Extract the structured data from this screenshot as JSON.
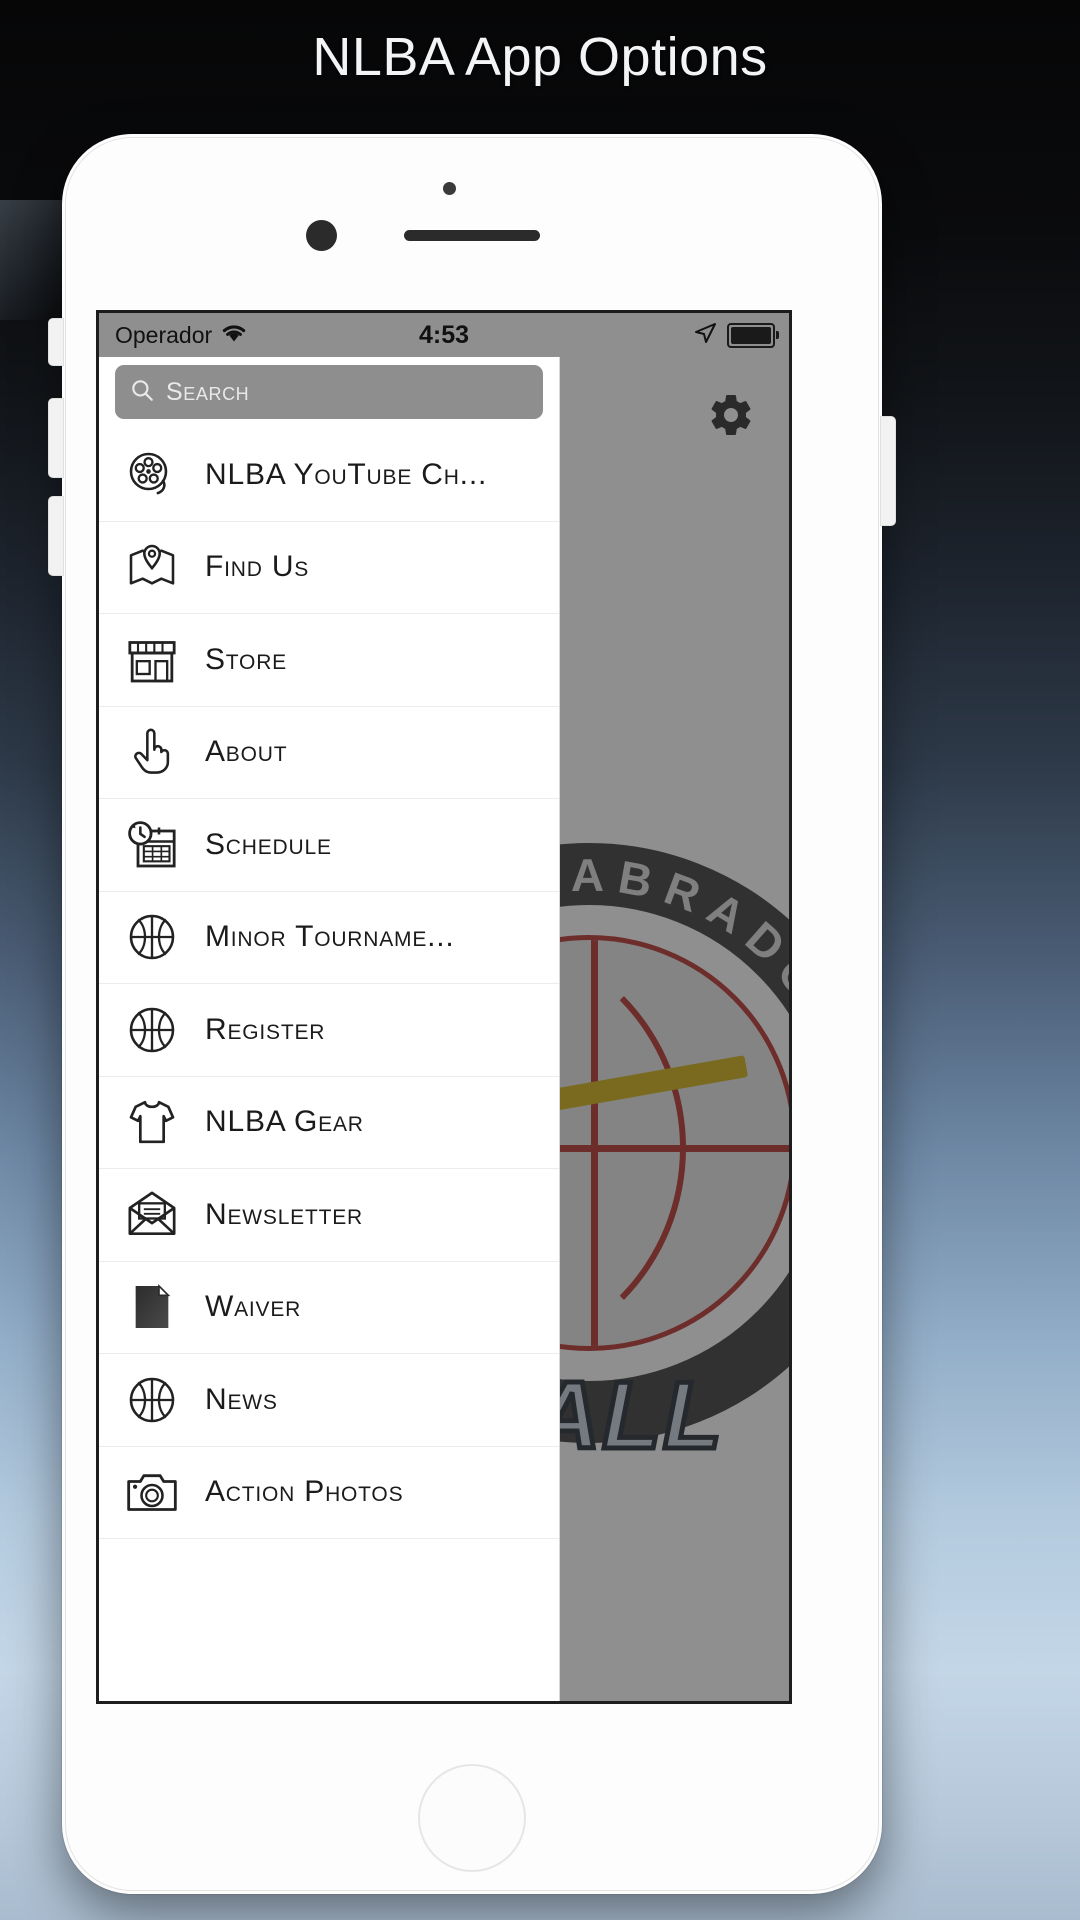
{
  "page": {
    "title": "NLBA App Options"
  },
  "device": {
    "status_bar": {
      "carrier": "Operador",
      "wifi_icon": "wifi-icon",
      "time": "4:53",
      "location_icon": "location-arrow-icon",
      "battery_icon": "battery-full-icon"
    },
    "home_button": "home-button"
  },
  "app": {
    "settings_icon": "gear-icon",
    "search": {
      "placeholder": "Search",
      "value": "",
      "icon": "search-icon"
    },
    "menu": [
      {
        "label": "NLBA YouTube Ch...",
        "icon": "film-reel-icon"
      },
      {
        "label": "Find Us",
        "icon": "map-pin-icon"
      },
      {
        "label": "Store",
        "icon": "storefront-icon"
      },
      {
        "label": "About",
        "icon": "pointing-hand-icon"
      },
      {
        "label": "Schedule",
        "icon": "calendar-clock-icon"
      },
      {
        "label": "Minor Tourname...",
        "icon": "basketball-icon"
      },
      {
        "label": "Register",
        "icon": "basketball-icon"
      },
      {
        "label": "NLBA Gear",
        "icon": "tshirt-icon"
      },
      {
        "label": "Newsletter",
        "icon": "envelope-open-icon"
      },
      {
        "label": "Waiver",
        "icon": "document-icon"
      },
      {
        "label": "News",
        "icon": "basketball-icon"
      },
      {
        "label": "Action Photos",
        "icon": "camera-icon"
      }
    ],
    "background_logo": {
      "ring_text": "O & LABRADOR",
      "word_text": "TBALL"
    }
  },
  "colors": {
    "logo_ring": "#3c3c3c",
    "logo_ball_line": "#b9322f",
    "logo_gold": "#d4b215",
    "search_field": "#8e8e8e",
    "overlay": "rgba(40,40,40,0.52)"
  }
}
